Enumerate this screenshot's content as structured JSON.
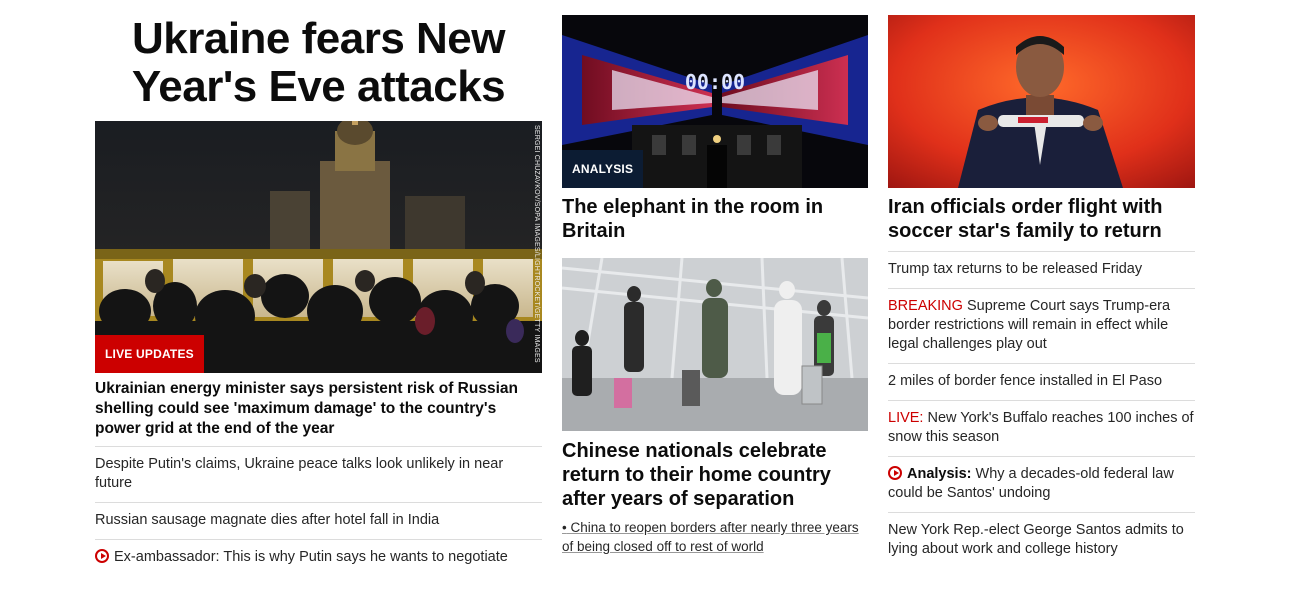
{
  "left": {
    "title": "Ukraine fears New Year's Eve attacks",
    "image_badge": "LIVE UPDATES",
    "image_credit": "SERGEI CHUZAVKOV/SOPA IMAGES/LIGHTROCKET/GETTY IMAGES",
    "headline": "Ukrainian energy minister says persistent risk of Russian shelling could see 'maximum damage' to the country's power grid at the end of the year",
    "items": [
      "Despite Putin's claims, Ukraine peace talks look unlikely in near future",
      "Russian sausage magnate dies after hotel fall in India",
      "Ex-ambassador: This is why Putin says he wants to negotiate"
    ]
  },
  "middle": {
    "story1": {
      "badge": "ANALYSIS",
      "clock_text": "00:00",
      "headline": "The elephant in the room in Britain"
    },
    "story2": {
      "headline": "Chinese nationals celebrate return to their home country after years of separation",
      "sub_bullet": "•",
      "sub_link": "China to reopen borders after nearly three years of being closed off to rest of world"
    }
  },
  "right": {
    "headline": "Iran officials order flight with soccer star's family to return",
    "items": [
      {
        "prefix": "",
        "prefix_style": "",
        "text": "Trump tax returns to be released Friday"
      },
      {
        "prefix": "BREAKING",
        "prefix_style": "red",
        "text": "Supreme Court says Trump-era border restrictions will remain in effect while legal challenges play out"
      },
      {
        "prefix": "",
        "prefix_style": "",
        "text": "2 miles of border fence installed in El Paso"
      },
      {
        "prefix": "LIVE:",
        "prefix_style": "red",
        "text": "New York's Buffalo reaches 100 inches of snow this season"
      },
      {
        "prefix": "Analysis:",
        "prefix_style": "bold",
        "text": "Why a decades-old federal law could be Santos' undoing"
      },
      {
        "prefix": "",
        "prefix_style": "",
        "text": "New York Rep.-elect George Santos admits to lying about work and college history"
      }
    ]
  },
  "colors": {
    "accent_red": "#cc0000",
    "analysis_navy": "#0c1c33",
    "divider": "#dcdcdc"
  },
  "icons": [
    "play-icon"
  ]
}
